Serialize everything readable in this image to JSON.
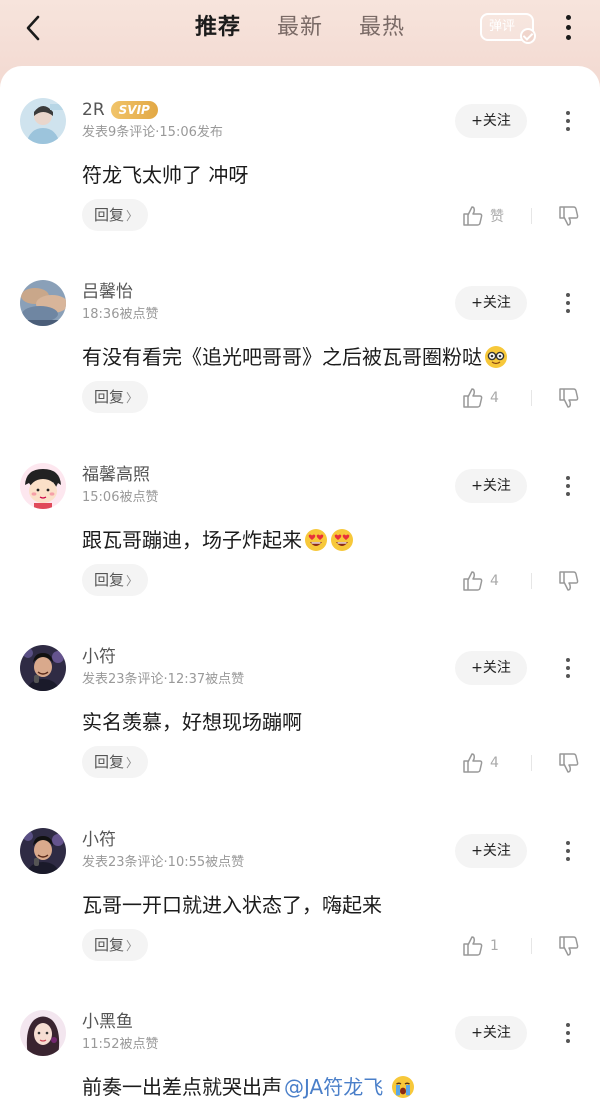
{
  "header": {
    "tabs": [
      {
        "label": "推荐",
        "active": true
      },
      {
        "label": "最新",
        "active": false
      },
      {
        "label": "最热",
        "active": false
      }
    ],
    "danmu_label": "弹评",
    "back_icon": "back-chevron-icon",
    "more_icon": "more-vertical-icon"
  },
  "actions": {
    "follow_label": "+关注",
    "reply_label": "回复"
  },
  "colors": {
    "header_bg": "#f3dbd3",
    "mention": "#4a7fc9",
    "svip_badge": "#e9b658"
  },
  "comments": [
    {
      "user": "2R",
      "badge": "SVIP",
      "meta": "发表9条评论·15:06发布",
      "text": "符龙飞太帅了 冲呀",
      "likes": "赞"
    },
    {
      "user": "吕馨怡",
      "meta": "18:36被点赞",
      "text": "有没有看完《追光吧哥哥》之后被瓦哥圈粉哒",
      "emoji": "nerd-face-emoji",
      "likes": "4"
    },
    {
      "user": "福馨高照",
      "meta": "15:06被点赞",
      "text": "跟瓦哥蹦迪，场子炸起来",
      "emoji": "heart-eyes-emoji",
      "likes": "4"
    },
    {
      "user": "小符",
      "meta": "发表23条评论·12:37被点赞",
      "text": "实名羡慕，好想现场蹦啊",
      "likes": "4"
    },
    {
      "user": "小符",
      "meta": "发表23条评论·10:55被点赞",
      "text": "瓦哥一开口就进入状态了，嗨起来",
      "likes": "1"
    },
    {
      "user": "小黑鱼",
      "meta": "11:52被点赞",
      "text": "前奏一出差点就哭出声",
      "mention": "@JA符龙飞",
      "emoji": "crying-face-emoji"
    }
  ]
}
